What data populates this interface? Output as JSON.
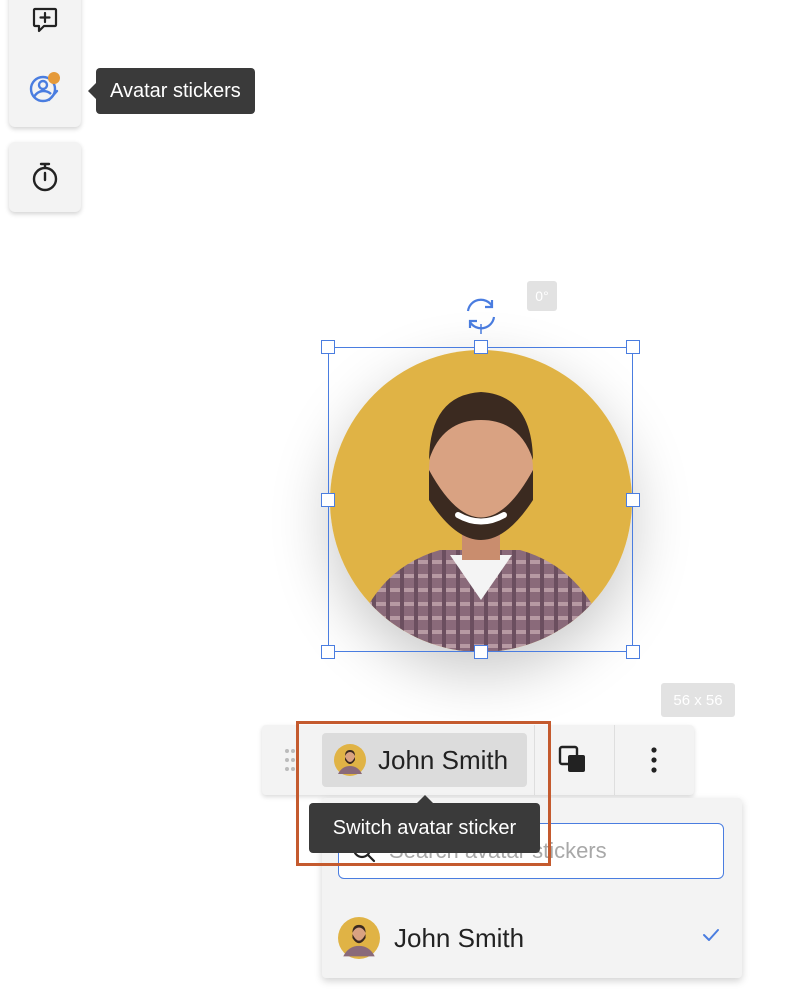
{
  "side_toolbar": {
    "tooltip": "Avatar stickers"
  },
  "canvas": {
    "rotation_label": "0°",
    "size_label": "56 x 56"
  },
  "sticker_toolbar": {
    "selected_avatar_name": "John Smith",
    "tooltip": "Switch avatar sticker"
  },
  "dropdown": {
    "search_placeholder": "Search avatar stickers",
    "items": [
      {
        "name": "John Smith",
        "selected": true
      }
    ]
  },
  "colors": {
    "accent": "#4a7de0",
    "notification_dot": "#e59a3a",
    "avatar_background": "#e0b345",
    "highlight_border": "#c45a2e"
  }
}
